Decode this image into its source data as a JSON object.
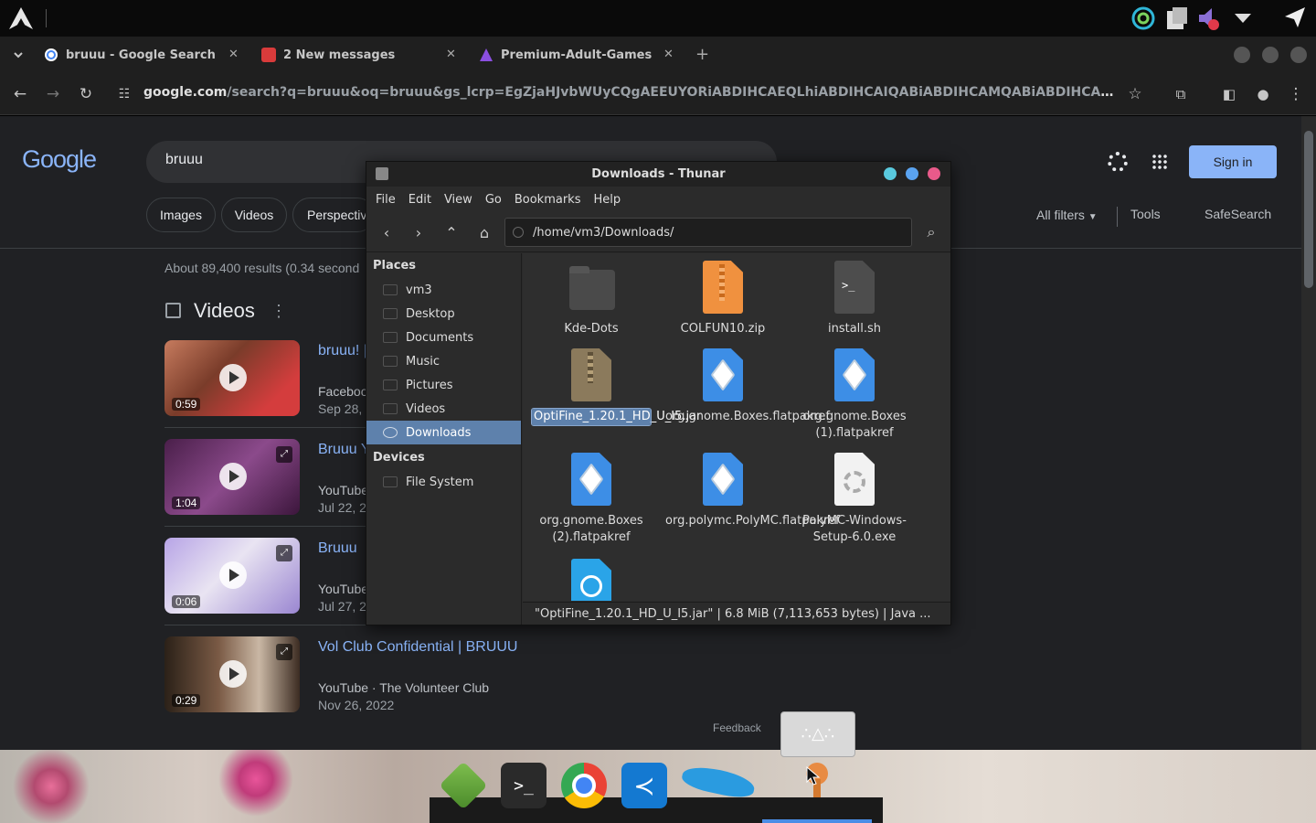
{
  "browser": {
    "tabs": [
      {
        "title": "bruuu - Google Search"
      },
      {
        "title": "2 New messages"
      },
      {
        "title": "Premium-Adult-Games"
      }
    ],
    "new_tab_symbol": "+",
    "url_host": "google.com",
    "url_rest": "/search?q=bruuu&oq=bruuu&gs_lcrp=EgZjaHJvbWUyCQgAEEUYORiABDIHCAEQLhiABDIHCAIQABiABDIHCAMQABiABDIHCAQQABiAB..."
  },
  "google": {
    "logo": "Google",
    "query": "bruuu",
    "chips": [
      "Images",
      "Videos",
      "Perspectiv"
    ],
    "all_filters": "All filters",
    "tools": "Tools",
    "safesearch": "SafeSearch",
    "sign_in": "Sign in",
    "results_count": "About 89,400 results (0.34 second",
    "videos_heading": "Videos",
    "feedback": "Feedback",
    "videos": [
      {
        "title": "bruuu! |",
        "source": "Faceboo",
        "date": "Sep 28, 2",
        "duration": "0:59"
      },
      {
        "title": "Bruuu Y",
        "source": "YouTube",
        "date": "Jul 22, 2",
        "duration": "1:04"
      },
      {
        "title": "Bruuu",
        "source": "YouTube",
        "date": "Jul 27, 2",
        "duration": "0:06"
      },
      {
        "title": "Vol Club Confidential | BRUUU",
        "source": "YouTube · The Volunteer Club",
        "date": "Nov 26, 2022",
        "duration": "0:29"
      }
    ]
  },
  "thunar": {
    "title": "Downloads - Thunar",
    "menu": [
      "File",
      "Edit",
      "View",
      "Go",
      "Bookmarks",
      "Help"
    ],
    "path": "/home/vm3/Downloads/",
    "places_heading": "Places",
    "places": [
      "vm3",
      "Desktop",
      "Documents",
      "Music",
      "Pictures",
      "Videos",
      "Downloads"
    ],
    "devices_heading": "Devices",
    "devices": [
      "File System"
    ],
    "files": [
      {
        "name": "Kde-Dots"
      },
      {
        "name": "COLFUN10.zip"
      },
      {
        "name": "install.sh"
      },
      {
        "name": "OptiFine_1.20.1_HD_U_I5.jar"
      },
      {
        "name": "org.gnome.Boxes.flatpakref"
      },
      {
        "name": "org.gnome.Boxes (1).flatpakref"
      },
      {
        "name": "org.gnome.Boxes (2).flatpakref"
      },
      {
        "name": "org.polymc.PolyMC.flatpakref"
      },
      {
        "name": "PolyMC-Windows-Setup-6.0.exe"
      }
    ],
    "status": "\"OptiFine_1.20.1_HD_U_I5.jar\"  |  6.8 MiB (7,113,653 bytes)  |  Java ..."
  },
  "colors": {
    "page_bg": "#202124",
    "link": "#8ab4f8",
    "signin_bg": "#8ab4f8",
    "selection": "#5e81ac"
  }
}
